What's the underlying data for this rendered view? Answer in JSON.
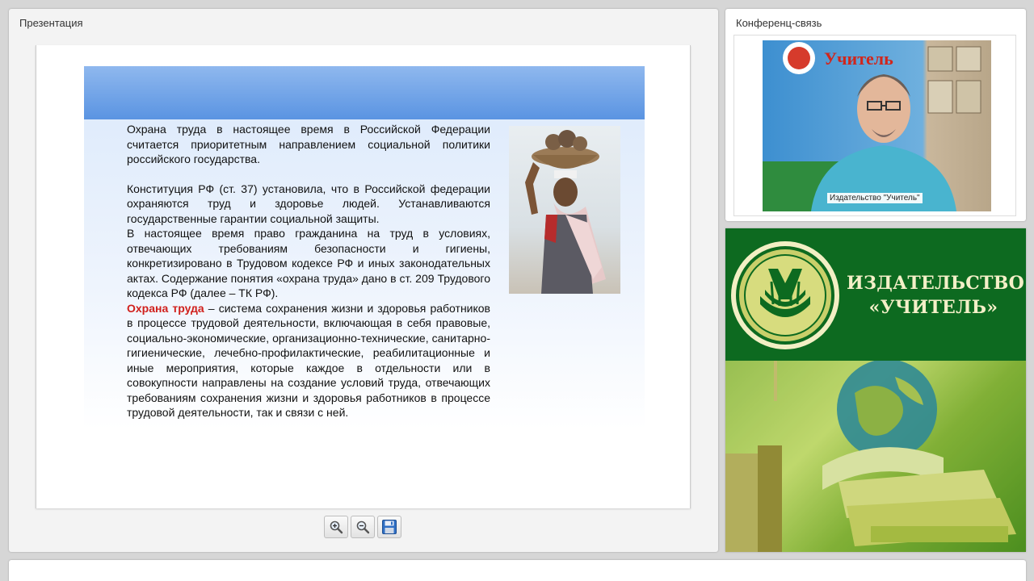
{
  "presentation": {
    "title": "Презентация",
    "slide": {
      "paragraph1": "Охрана труда в настоящее время в Российской Федерации считается приоритетным направлением социальной политики российского государства.",
      "paragraph2": "Конституция РФ (ст. 37) установила, что в Российской федерации охраняются труд и здоровье людей. Устанавливаются государственные гарантии социальной защиты.",
      "paragraph3": "В настоящее время право гражданина на труд в условиях, отвечающих требованиям безопасности и гигиены, конкретизировано в Трудовом кодексе РФ и иных законодательных актах. Содержание понятия «охрана труда» дано в ст. 209 Трудового кодекса РФ (далее – ТК РФ).",
      "term": "Охрана труда",
      "definition": " – система сохранения жизни и здоровья работников в процессе трудовой деятельности, включающая в себя правовые, социально-экономические, организационно-технические, санитарно-гигиенические, лечебно-профилактические, реабилитационные и иные мероприятия, которые каждое в отдельности или в совокупности направлены на создание условий труда, отвечающих требованиям сохранения жизни и здоровья работников в процессе трудовой деятельности, так и связи с ней."
    },
    "toolbar": {
      "zoom_in_icon": "zoom-in-icon",
      "zoom_out_icon": "zoom-out-icon",
      "save_icon": "floppy-disk-icon"
    }
  },
  "conference": {
    "title": "Конференц-связь",
    "video_label": "Издательство \"Учитель\"",
    "banner_logo_text": "Учитель"
  },
  "publisher": {
    "name_line1": "ИЗДАТЕЛЬСТВО",
    "name_line2": "«УЧИТЕЛЬ»"
  }
}
